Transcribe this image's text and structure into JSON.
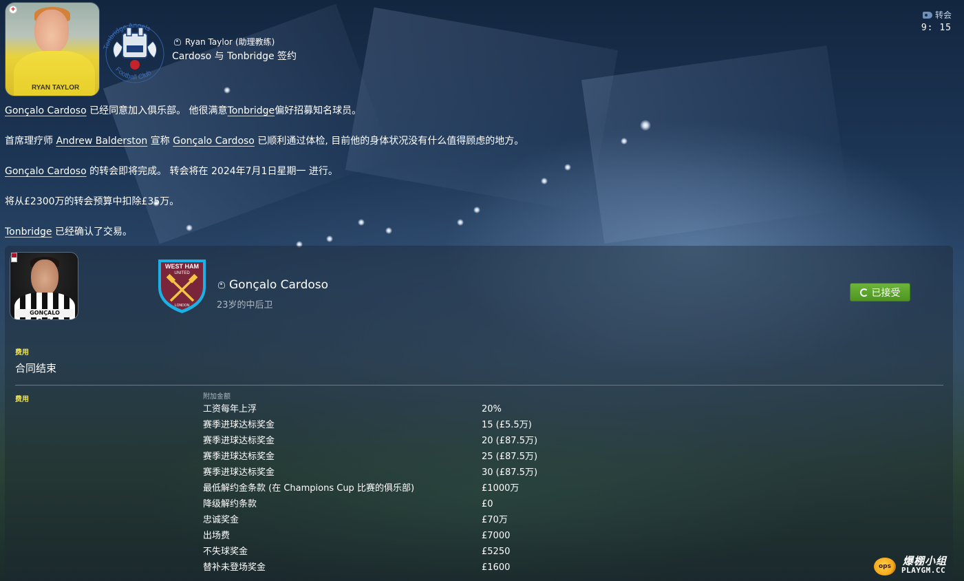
{
  "header": {
    "author_name": "Ryan Taylor",
    "author_role": "(助理教练)",
    "subject": "Cardoso 与 Tonbridge 签约",
    "photo_shirt_text": "RYAN TAYLOR",
    "crest_text_top": "Tonbridge Angels",
    "crest_text_bottom": "Football Club"
  },
  "top_right": {
    "tag_label": "转会",
    "time": "9: 15"
  },
  "body": {
    "p1_link": "Gonçalo Cardoso",
    "p1_text_a": " 已经同意加入俱乐部。 他很满意",
    "p1_link2": "Tonbridge",
    "p1_text_b": "偏好招募知名球员。",
    "p2_text_a": "首席理疗师 ",
    "p2_link": "Andrew Balderston",
    "p2_text_b": " 宣称 ",
    "p2_link2": "Gonçalo Cardoso",
    "p2_text_c": " 已顺利通过体检, 目前他的身体状况没有什么值得顾虑的地方。",
    "p3_link": "Gonçalo Cardoso",
    "p3_text": " 的转会即将完成。 转会将在 2024年7月1日星期一 进行。",
    "p4_text": "将从£2300万的转会预算中扣除£35万。",
    "p5_link": "Tonbridge",
    "p5_text": " 已经确认了交易。"
  },
  "transfer": {
    "player_name": "Gonçalo Cardoso",
    "player_desc": "23岁的中后卫",
    "player_photo_name": "GONÇALO CARDOSO",
    "club_crest_top": "WEST HAM",
    "club_crest_mid": "UNITED",
    "club_crest_bottom": "LONDON",
    "status_button": "已接受",
    "fee_label": "费用",
    "fee_value": "合同结束",
    "fee_label2": "费用",
    "clauses_header": "附加金额",
    "clauses": [
      {
        "name": "工资每年上浮",
        "value": "20%"
      },
      {
        "name": "赛季进球达标奖金",
        "value": "15 (£5.5万)"
      },
      {
        "name": "赛季进球达标奖金",
        "value": "20 (£87.5万)"
      },
      {
        "name": "赛季进球达标奖金",
        "value": "25 (£87.5万)"
      },
      {
        "name": "赛季进球达标奖金",
        "value": "30 (£87.5万)"
      },
      {
        "name": "最低解约金条款 (在 Champions Cup 比赛的俱乐部)",
        "value": "£1000万"
      },
      {
        "name": "降级解约条款",
        "value": "£0"
      },
      {
        "name": "忠诚奖金",
        "value": "£70万"
      },
      {
        "name": "出场费",
        "value": "£7000"
      },
      {
        "name": "不失球奖金",
        "value": "£5250"
      },
      {
        "name": "替补未登场奖金",
        "value": "£1600"
      }
    ]
  },
  "watermark": {
    "logo_text": "ops",
    "title": "爆棚小组",
    "sub": "PLAYGM.CC"
  },
  "icons": {
    "person": "person-icon",
    "tag": "tag-icon",
    "refresh": "refresh-icon",
    "flag": "england-flag-icon"
  },
  "colors": {
    "accent_green": "#5ea52d",
    "fee_label_yellow": "#f3e34a",
    "crest_claret": "#7a263a",
    "crest_blue": "#1bb1e7"
  }
}
